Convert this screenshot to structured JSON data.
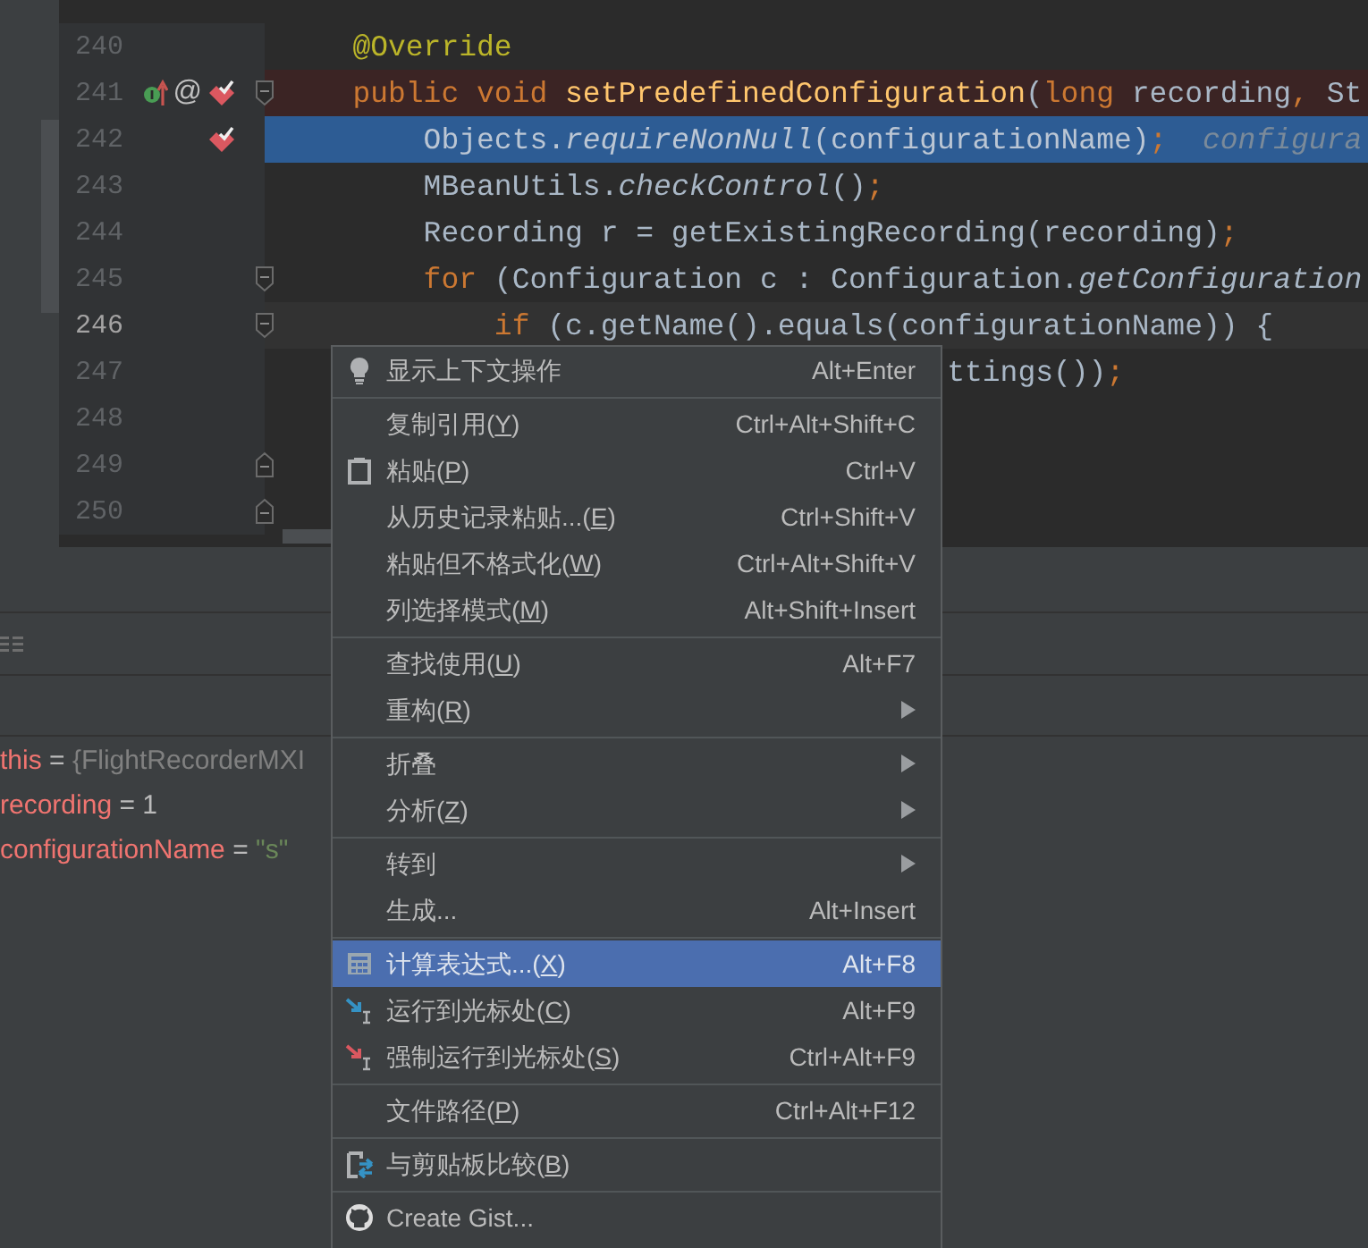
{
  "editor": {
    "lines": [
      {
        "number": "240",
        "breakpoint_line": false,
        "execution_line": false,
        "caret_line": false,
        "clipped_left": false,
        "fold_start": false,
        "fold_end": false,
        "tokens": [
          {
            "text": "    @Override",
            "kind": "annotation"
          }
        ]
      },
      {
        "number": "241",
        "breakpoint_line": true,
        "execution_line": false,
        "caret_line": false,
        "clipped_left": false,
        "fold_start": true,
        "fold_end": false,
        "gutter_marks": [
          {
            "kind": "override"
          },
          {
            "kind": "annotation",
            "text": "@"
          },
          {
            "kind": "breakpoint"
          }
        ],
        "tokens": [
          {
            "text": "    public void ",
            "kind": "keyword"
          },
          {
            "text": "setPredefinedConfiguration",
            "kind": "declaration"
          },
          {
            "text": "(",
            "kind": "plain"
          },
          {
            "text": "long ",
            "kind": "keyword"
          },
          {
            "text": "recording",
            "kind": "plain"
          },
          {
            "text": ", ",
            "kind": "keyword"
          },
          {
            "text": "St",
            "kind": "plain"
          }
        ]
      },
      {
        "number": "242",
        "breakpoint_line": false,
        "execution_line": true,
        "caret_line": false,
        "clipped_left": false,
        "fold_start": false,
        "fold_end": false,
        "gutter_marks": [
          {
            "kind": "breakpoint"
          }
        ],
        "tokens": [
          {
            "text": "        Objects.",
            "kind": "plain"
          },
          {
            "text": "requireNonNull",
            "kind": "static"
          },
          {
            "text": "(configurationName)",
            "kind": "plain"
          },
          {
            "text": ";",
            "kind": "keyword"
          },
          {
            "text": "  configura",
            "kind": "hint"
          }
        ]
      },
      {
        "number": "243",
        "breakpoint_line": false,
        "execution_line": false,
        "caret_line": false,
        "clipped_left": false,
        "fold_start": false,
        "fold_end": false,
        "tokens": [
          {
            "text": "        MBeanUtils.",
            "kind": "plain"
          },
          {
            "text": "checkControl",
            "kind": "static"
          },
          {
            "text": "()",
            "kind": "plain"
          },
          {
            "text": ";",
            "kind": "keyword"
          }
        ]
      },
      {
        "number": "244",
        "breakpoint_line": false,
        "execution_line": false,
        "caret_line": false,
        "clipped_left": false,
        "fold_start": false,
        "fold_end": false,
        "tokens": [
          {
            "text": "        Recording r = getExistingRecording(recording)",
            "kind": "plain"
          },
          {
            "text": ";",
            "kind": "keyword"
          }
        ]
      },
      {
        "number": "245",
        "breakpoint_line": false,
        "execution_line": false,
        "caret_line": false,
        "clipped_left": false,
        "fold_start": true,
        "fold_end": false,
        "tokens": [
          {
            "text": "        for",
            "kind": "keyword"
          },
          {
            "text": " (Configuration c : Configuration.",
            "kind": "plain"
          },
          {
            "text": "getConfiguration",
            "kind": "static"
          }
        ]
      },
      {
        "number": "246",
        "breakpoint_line": false,
        "execution_line": false,
        "caret_line": true,
        "clipped_left": false,
        "fold_start": true,
        "fold_end": false,
        "tokens": [
          {
            "text": "            if",
            "kind": "keyword"
          },
          {
            "text": " (c.getName().equals(configurationName)) {",
            "kind": "plain"
          }
        ]
      },
      {
        "number": "247",
        "breakpoint_line": false,
        "execution_line": false,
        "caret_line": false,
        "clipped_left": true,
        "fold_start": false,
        "fold_end": false,
        "tokens": [
          {
            "text": "ttings())",
            "kind": "plain"
          },
          {
            "text": ";",
            "kind": "keyword"
          }
        ]
      },
      {
        "number": "248",
        "breakpoint_line": false,
        "execution_line": false,
        "caret_line": false,
        "fold_start": false,
        "fold_end": false
      },
      {
        "number": "249",
        "breakpoint_line": false,
        "execution_line": false,
        "caret_line": false,
        "fold_start": false,
        "fold_end": true
      },
      {
        "number": "250",
        "breakpoint_line": false,
        "execution_line": false,
        "caret_line": false,
        "fold_start": false,
        "fold_end": true
      }
    ]
  },
  "variables": [
    {
      "name": "this",
      "sign": "=",
      "value": "{FlightRecorderMXI",
      "kind": "object"
    },
    {
      "name": "recording",
      "sign": "=",
      "value": "1",
      "kind": "number"
    },
    {
      "name": "configurationName",
      "sign": "=",
      "value": "\"s\"",
      "kind": "string"
    }
  ],
  "menu": {
    "groups": [
      {
        "items": [
          {
            "label_parts": [
              "显示上下文操作"
            ],
            "shortcut": "Alt+Enter",
            "submenu": false,
            "selected": false
          }
        ]
      },
      {
        "items": [
          {
            "label_parts": [
              "复制引用(",
              "Y",
              ")"
            ],
            "shortcut": "Ctrl+Alt+Shift+C",
            "submenu": false,
            "selected": false
          },
          {
            "label_parts": [
              "粘贴(",
              "P",
              ")"
            ],
            "shortcut": "Ctrl+V",
            "submenu": false,
            "selected": false
          },
          {
            "label_parts": [
              "从历史记录粘贴...(",
              "E",
              ")"
            ],
            "shortcut": "Ctrl+Shift+V",
            "submenu": false,
            "selected": false
          },
          {
            "label_parts": [
              "粘贴但不格式化(",
              "W",
              ")"
            ],
            "shortcut": "Ctrl+Alt+Shift+V",
            "submenu": false,
            "selected": false
          },
          {
            "label_parts": [
              "列选择模式(",
              "M",
              ")"
            ],
            "shortcut": "Alt+Shift+Insert",
            "submenu": false,
            "selected": false
          }
        ]
      },
      {
        "items": [
          {
            "label_parts": [
              "查找使用(",
              "U",
              ")"
            ],
            "shortcut": "Alt+F7",
            "submenu": false,
            "selected": false
          },
          {
            "label_parts": [
              "重构(",
              "R",
              ")"
            ],
            "submenu": true,
            "selected": false
          }
        ]
      },
      {
        "items": [
          {
            "label_parts": [
              "折叠"
            ],
            "submenu": true,
            "selected": false
          },
          {
            "label_parts": [
              "分析(",
              "Z",
              ")"
            ],
            "submenu": true,
            "selected": false
          }
        ]
      },
      {
        "items": [
          {
            "label_parts": [
              "转到"
            ],
            "submenu": true,
            "selected": false
          },
          {
            "label_parts": [
              "生成..."
            ],
            "shortcut": "Alt+Insert",
            "submenu": false,
            "selected": false
          }
        ]
      },
      {
        "items": [
          {
            "label_parts": [
              "计算表达式...(",
              "X",
              ")"
            ],
            "shortcut": "Alt+F8",
            "submenu": false,
            "selected": true
          },
          {
            "label_parts": [
              "运行到光标处(",
              "C",
              ")"
            ],
            "shortcut": "Alt+F9",
            "submenu": false,
            "selected": false
          },
          {
            "label_parts": [
              "强制运行到光标处(",
              "S",
              ")"
            ],
            "shortcut": "Ctrl+Alt+F9",
            "submenu": false,
            "selected": false
          }
        ]
      },
      {
        "items": [
          {
            "label_parts": [
              "文件路径(",
              "P",
              ")"
            ],
            "shortcut": "Ctrl+Alt+F12",
            "submenu": false,
            "selected": false
          }
        ]
      },
      {
        "items": [
          {
            "label_parts": [
              "与剪贴板比较(",
              "B",
              ")"
            ],
            "submenu": false,
            "selected": false
          }
        ]
      },
      {
        "items": [
          {
            "label_parts": [
              "Create Gist..."
            ],
            "submenu": false,
            "selected": false
          }
        ]
      }
    ]
  }
}
